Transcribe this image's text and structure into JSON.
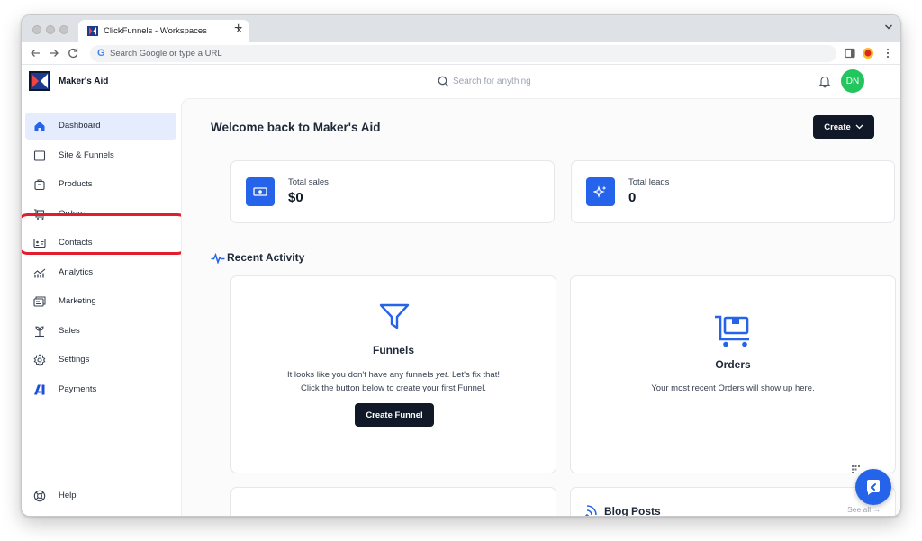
{
  "browser": {
    "tab_title": "ClickFunnels - Workspaces",
    "tab_close": "×",
    "new_tab": "+",
    "address_placeholder": "Search Google or type a URL"
  },
  "header": {
    "brand": "Maker's Aid",
    "search_placeholder": "Search for anything",
    "avatar_initials": "DN"
  },
  "sidebar": {
    "items": [
      {
        "label": "Dashboard",
        "icon": "home-icon",
        "active": true
      },
      {
        "label": "Site & Funnels",
        "icon": "browser-window-icon"
      },
      {
        "label": "Products",
        "icon": "package-icon"
      },
      {
        "label": "Orders",
        "icon": "cart-icon"
      },
      {
        "label": "Contacts",
        "icon": "contact-card-icon"
      },
      {
        "label": "Analytics",
        "icon": "analytics-icon"
      },
      {
        "label": "Marketing",
        "icon": "marketing-icon"
      },
      {
        "label": "Sales",
        "icon": "sales-icon"
      },
      {
        "label": "Settings",
        "icon": "gear-icon"
      },
      {
        "label": "Payments",
        "icon": "payments-logo-icon"
      }
    ],
    "help_label": "Help"
  },
  "main": {
    "welcome": "Welcome back to Maker's Aid",
    "create_label": "Create",
    "stats": [
      {
        "label": "Total sales",
        "value": "$0",
        "icon": "money-icon"
      },
      {
        "label": "Total leads",
        "value": "0",
        "icon": "sparkles-icon"
      }
    ],
    "recent_activity_title": "Recent Activity",
    "funnels_card": {
      "title": "Funnels",
      "text_line1_a": "It looks like you don't have any funnels ",
      "text_line1_em": "yet",
      "text_line1_b": ". Let's fix that!",
      "text_line2": "Click the button below to create your first Funnel.",
      "button": "Create Funnel"
    },
    "orders_card": {
      "title": "Orders",
      "text": "Your most recent Orders will show up here."
    },
    "blog_title": "Blog Posts",
    "see_all": "See all →"
  },
  "colors": {
    "accent": "#2563eb",
    "active_nav_bg": "#e4ecfd",
    "dark_button": "#111827",
    "avatar": "#22c55e",
    "highlight": "#e11d2e"
  }
}
